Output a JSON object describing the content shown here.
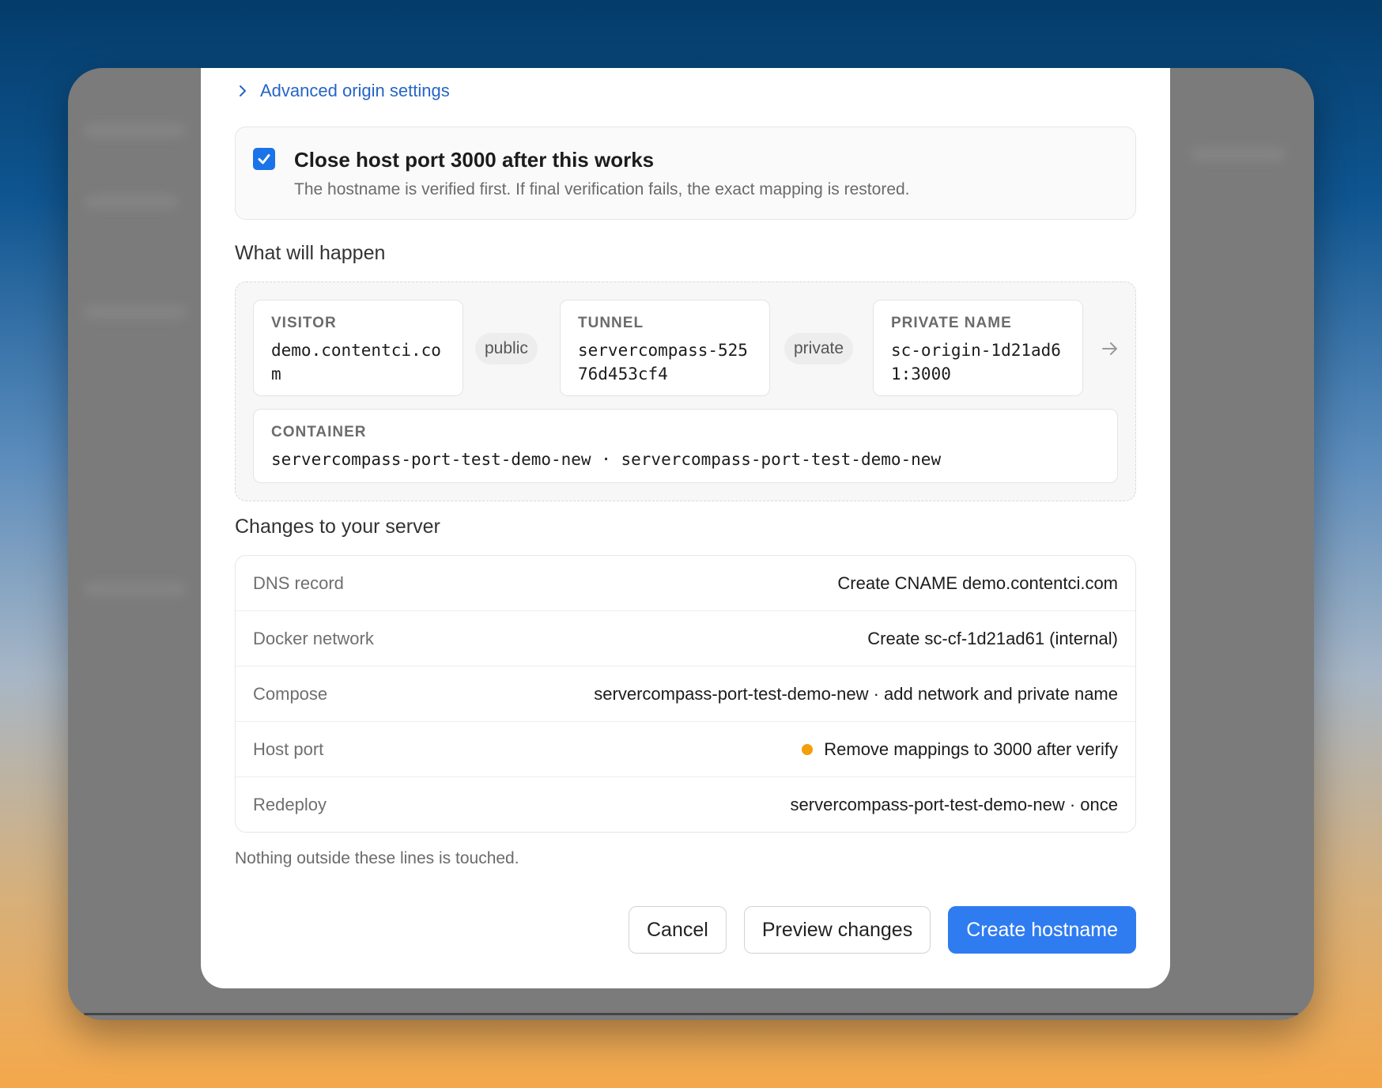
{
  "modal": {
    "advanced_link": "Advanced origin settings",
    "close_port": {
      "checked": true,
      "title": "Close host port 3000 after this works",
      "description": "The hostname is verified first. If final verification fails, the exact mapping is restored."
    },
    "what_will_happen": {
      "title": "What will happen",
      "visitor": {
        "label": "VISITOR",
        "value": "demo.contentci.com"
      },
      "public_pill": "public",
      "tunnel": {
        "label": "TUNNEL",
        "value": "servercompass-52576d453cf4"
      },
      "private_pill": "private",
      "private_name": {
        "label": "PRIVATE NAME",
        "value": "sc-origin-1d21ad61:3000"
      },
      "container": {
        "label": "CONTAINER",
        "value": "servercompass-port-test-demo-new · servercompass-port-test-demo-new"
      }
    },
    "changes": {
      "title": "Changes to your server",
      "rows": [
        {
          "label": "DNS record",
          "value": "Create CNAME demo.contentci.com"
        },
        {
          "label": "Docker network",
          "value": "Create sc-cf-1d21ad61 (internal)"
        },
        {
          "label": "Compose",
          "value": "servercompass-port-test-demo-new · add network and private name"
        },
        {
          "label": "Host port",
          "value": "Remove mappings to 3000 after verify",
          "status_color": "#f29f0b"
        },
        {
          "label": "Redeploy",
          "value": "servercompass-port-test-demo-new · once"
        }
      ],
      "footnote": "Nothing outside these lines is touched."
    },
    "buttons": {
      "cancel": "Cancel",
      "preview": "Preview changes",
      "create": "Create hostname"
    }
  },
  "colors": {
    "accent": "#2f7cf0",
    "link": "#2565c7",
    "warning_dot": "#f29f0b"
  }
}
